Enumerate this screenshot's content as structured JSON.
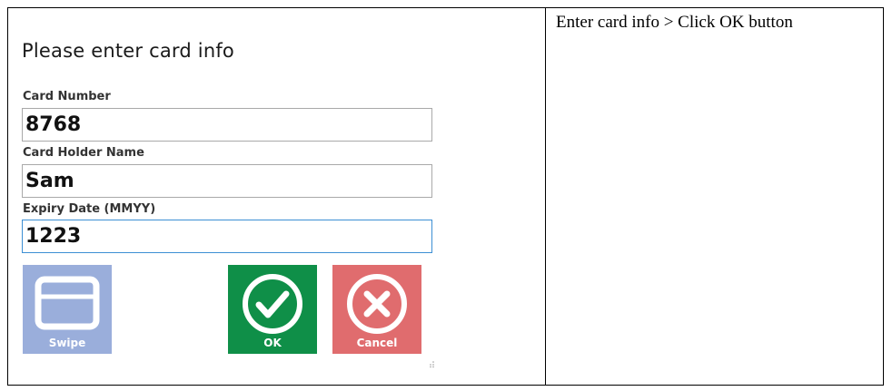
{
  "instruction": "Enter card info > Click OK button",
  "dialog": {
    "title": "Please enter card info",
    "fields": [
      {
        "label": "Card Number",
        "value": "8768"
      },
      {
        "label": "Card Holder Name",
        "value": "Sam"
      },
      {
        "label": "Expiry Date (MMYY)",
        "value": "1223"
      }
    ],
    "buttons": {
      "swipe": {
        "label": "Swipe",
        "icon": "card-icon",
        "color": "#9aaedb"
      },
      "ok": {
        "label": "OK",
        "icon": "checkmark-circle-icon",
        "color": "#0f8f48"
      },
      "cancel": {
        "label": "Cancel",
        "icon": "x-circle-icon",
        "color": "#e06c6e"
      }
    }
  }
}
